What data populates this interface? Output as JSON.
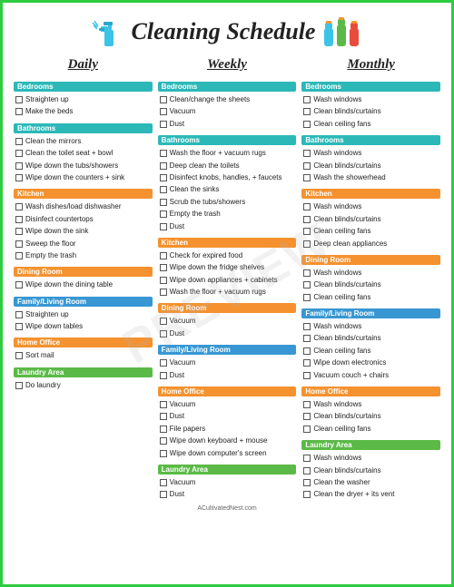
{
  "header": {
    "title": "Cleaning Schedule",
    "footer": "ACultivatedNest.com"
  },
  "watermark": "PREVIEW",
  "columns": [
    {
      "title": "Daily",
      "sections": [
        {
          "label": "Bedrooms",
          "color": "bg-teal",
          "tasks": [
            "Straighten up",
            "Make the beds"
          ]
        },
        {
          "label": "Bathrooms",
          "color": "bg-teal",
          "tasks": [
            "Clean the mirrors",
            "Clean the toilet seat + bowl",
            "Wipe down the tubs/showers",
            "Wipe down the counters + sink"
          ]
        },
        {
          "label": "Kitchen",
          "color": "bg-orange",
          "tasks": [
            "Wash dishes/load dishwasher",
            "Disinfect countertops",
            "Wipe down the sink",
            "Sweep the floor",
            "Empty the trash"
          ]
        },
        {
          "label": "Dining Room",
          "color": "bg-orange",
          "tasks": [
            "Wipe down the dining table"
          ]
        },
        {
          "label": "Family/Living Room",
          "color": "bg-blue",
          "tasks": [
            "Straighten up",
            "Wipe down tables"
          ]
        },
        {
          "label": "Home Office",
          "color": "bg-orange",
          "tasks": [
            "Sort mail"
          ]
        },
        {
          "label": "Laundry Area",
          "color": "bg-green",
          "tasks": [
            "Do laundry"
          ]
        }
      ]
    },
    {
      "title": "Weekly",
      "sections": [
        {
          "label": "Bedrooms",
          "color": "bg-teal",
          "tasks": [
            "Clean/change the sheets",
            "Vacuum",
            "Dust"
          ]
        },
        {
          "label": "Bathrooms",
          "color": "bg-teal",
          "tasks": [
            "Wash the floor + vacuum rugs",
            "Deep clean the toilets",
            "Disinfect knobs, handles, + faucets",
            "Clean the sinks",
            "Scrub the tubs/showers",
            "Empty the trash",
            "Dust"
          ]
        },
        {
          "label": "Kitchen",
          "color": "bg-orange",
          "tasks": [
            "Check for expired food",
            "Wipe down the fridge shelves",
            "Wipe down appliances + cabinets",
            "Wash the floor + vacuum rugs"
          ]
        },
        {
          "label": "Dining Room",
          "color": "bg-orange",
          "tasks": [
            "Vacuum",
            "Dust"
          ]
        },
        {
          "label": "Family/Living Room",
          "color": "bg-blue",
          "tasks": [
            "Vacuum",
            "Dust"
          ]
        },
        {
          "label": "Home Office",
          "color": "bg-orange",
          "tasks": [
            "Vacuum",
            "Dust",
            "File papers",
            "Wipe down keyboard + mouse",
            "Wipe down computer's screen"
          ]
        },
        {
          "label": "Laundry Area",
          "color": "bg-green",
          "tasks": [
            "Vacuum",
            "Dust"
          ]
        }
      ]
    },
    {
      "title": "Monthly",
      "sections": [
        {
          "label": "Bedrooms",
          "color": "bg-teal",
          "tasks": [
            "Wash windows",
            "Clean blinds/curtains",
            "Clean ceiling fans"
          ]
        },
        {
          "label": "Bathrooms",
          "color": "bg-teal",
          "tasks": [
            "Wash windows",
            "Clean blinds/curtains",
            "Wash the showerhead"
          ]
        },
        {
          "label": "Kitchen",
          "color": "bg-orange",
          "tasks": [
            "Wash windows",
            "Clean blinds/curtains",
            "Clean ceiling fans",
            "Deep clean appliances"
          ]
        },
        {
          "label": "Dining Room",
          "color": "bg-orange",
          "tasks": [
            "Wash windows",
            "Clean blinds/curtains",
            "Clean ceiling fans"
          ]
        },
        {
          "label": "Family/Living Room",
          "color": "bg-blue",
          "tasks": [
            "Wash windows",
            "Clean blinds/curtains",
            "Clean ceiling fans",
            "Wipe down electronics",
            "Vacuum couch + chairs"
          ]
        },
        {
          "label": "Home Office",
          "color": "bg-orange",
          "tasks": [
            "Wash windows",
            "Clean blinds/curtains",
            "Clean ceiling fans"
          ]
        },
        {
          "label": "Laundry Area",
          "color": "bg-green",
          "tasks": [
            "Wash windows",
            "Clean blinds/curtains",
            "Clean the washer",
            "Clean the dryer + its vent"
          ]
        }
      ]
    }
  ]
}
